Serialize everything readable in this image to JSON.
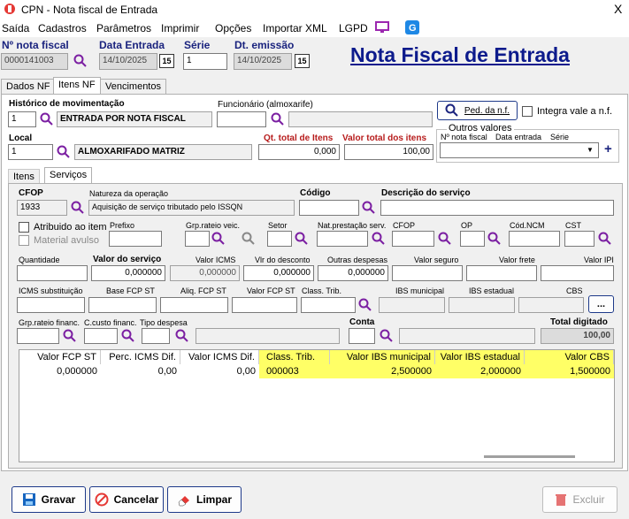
{
  "window": {
    "title": "CPN - Nota fiscal de Entrada",
    "close": "X"
  },
  "menu": [
    "Saída",
    "Cadastros",
    "Parâmetros",
    "Imprimir",
    "Opções",
    "Importar XML",
    "LGPD"
  ],
  "header": {
    "nota_label": "Nº nota fiscal",
    "nota_value": "0000141003",
    "data_entrada_label": "Data Entrada",
    "data_entrada_value": "14/10/2025",
    "serie_label": "Série",
    "serie_value": "1",
    "emissao_label": "Dt. emissão",
    "emissao_value": "14/10/2025",
    "page_title": "Nota Fiscal de Entrada",
    "calendar_glyph": "15"
  },
  "tabs": [
    "Dados NF",
    "Itens NF",
    "Vencimentos"
  ],
  "form": {
    "historico_label": "Histórico de movimentação",
    "historico_code": "1",
    "historico_desc": "ENTRADA POR NOTA FISCAL",
    "funcionario_label": "Funcionário (almoxarife)",
    "ped_button": "Ped. da n.f.",
    "integra_label": "Integra vale a n.f.",
    "outros_label": "Outros valores",
    "outros_nota": "Nº nota fiscal",
    "outros_data": "Data entrada",
    "outros_serie": "Série",
    "plus": "+",
    "local_label": "Local",
    "local_code": "1",
    "local_desc": "ALMOXARIFADO MATRIZ",
    "qt_label": "Qt. total de Itens",
    "qt_value": "0,000",
    "valor_total_label": "Valor total dos itens",
    "valor_total_value": "100,00"
  },
  "subtabs": [
    "Itens",
    "Serviços"
  ],
  "servicos": {
    "cfop_label": "CFOP",
    "cfop_value": "1933",
    "natureza_label": "Natureza da operação",
    "natureza_value": "Aquisição de serviço tributado pelo ISSQN",
    "codigo_label": "Código",
    "descricao_label": "Descrição do serviço",
    "atribuido_label": "Atribuido ao item",
    "material_label": "Material avulso",
    "prefixo_label": "Prefixo",
    "grp_rateio_label": "Grp.rateio veic.",
    "setor_label": "Setor",
    "nat_prest_label": "Nat.prestação serv.",
    "cfop2_label": "CFOP",
    "op_label": "OP",
    "ncm_label": "Cód.NCM",
    "cst_label": "CST",
    "quantidade_label": "Quantidade",
    "valor_servico_label": "Valor do serviço",
    "valor_servico_value": "0,000000",
    "icms_label": "Valor ICMS",
    "icms_value": "0,000000",
    "desconto_label": "Vlr do desconto",
    "desconto_value": "0,000000",
    "outras_label": "Outras despesas",
    "outras_value": "0,000000",
    "seguro_label": "Valor seguro",
    "frete_label": "Valor frete",
    "ipi_label": "Valor IPI",
    "icms_sub_label": "ICMS substituição",
    "base_fcp_label": "Base FCP ST",
    "aliq_fcp_label": "Aliq. FCP ST",
    "valor_fcp_label": "Valor FCP ST",
    "class_trib_label": "Class. Trib.",
    "ibs_mun_label": "IBS municipal",
    "ibs_est_label": "IBS estadual",
    "cbs_label": "CBS",
    "ellipsis": "...",
    "grp_fin_label": "Grp.rateio financ.",
    "custo_label": "C.custo financ.",
    "tipo_label": "Tipo despesa",
    "conta_label": "Conta",
    "total_digitado_label": "Total digitado",
    "total_digitado_value": "100,00"
  },
  "grid": {
    "headers": [
      "Valor FCP ST",
      "Perc. ICMS Dif.",
      "Valor ICMS Dif.",
      "Class. Trib.",
      "Valor IBS municipal",
      "Valor IBS estadual",
      "Valor CBS"
    ],
    "row": [
      "0,000000",
      "0,00",
      "0,00",
      "000003",
      "2,500000",
      "2,000000",
      "1,500000"
    ],
    "highlight": "#ffff66"
  },
  "footer": {
    "gravar": "Gravar",
    "cancelar": "Cancelar",
    "limpar": "Limpar",
    "excluir": "Excluir"
  }
}
